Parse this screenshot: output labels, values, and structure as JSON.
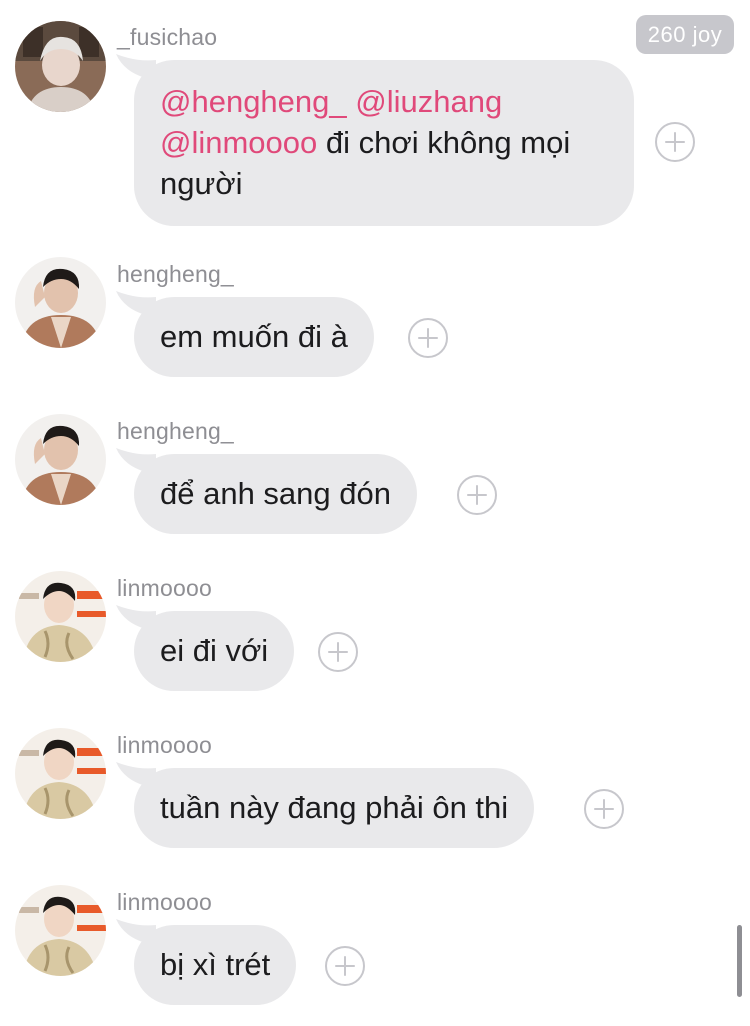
{
  "badge": {
    "text": "260 joy"
  },
  "messages": [
    {
      "username": "_fusichao",
      "avatar": "avatar-fusichao",
      "parts": [
        {
          "text": "@hengheng_",
          "mention": true
        },
        {
          "text": " ",
          "mention": false
        },
        {
          "text": "@liuzhang",
          "mention": true
        },
        {
          "text": " ",
          "mention": false
        },
        {
          "text": "@linmoooo",
          "mention": true
        },
        {
          "text": " đi chơi không mọi người",
          "mention": false
        }
      ]
    },
    {
      "username": "hengheng_",
      "avatar": "avatar-hengheng",
      "text": "em muốn đi à"
    },
    {
      "username": "hengheng_",
      "avatar": "avatar-hengheng",
      "text": "để anh sang đón"
    },
    {
      "username": "linmoooo",
      "avatar": "avatar-linmoooo",
      "text": "ei đi với"
    },
    {
      "username": "linmoooo",
      "avatar": "avatar-linmoooo",
      "text": "tuần này đang phải ôn thi"
    },
    {
      "username": "linmoooo",
      "avatar": "avatar-linmoooo",
      "text": "bị xì trét"
    }
  ],
  "icons": {
    "reaction": "add-reaction-icon"
  },
  "colors": {
    "bubble": "#e9e9eb",
    "mention": "#e0497a",
    "username": "#8e8e93",
    "badge": "#c7c7cc"
  }
}
